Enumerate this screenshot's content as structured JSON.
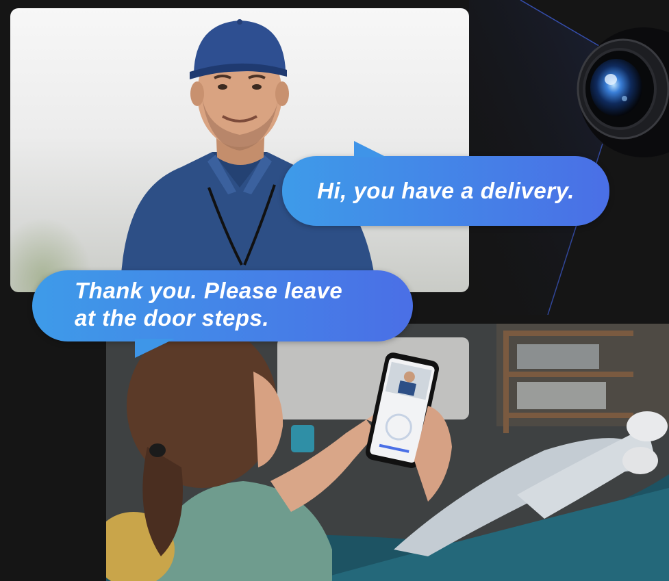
{
  "chat": {
    "incoming_message": "Hi, you have a delivery.",
    "reply_message": "Thank you. Please leave\nat the door steps."
  },
  "colors": {
    "background": "#151515",
    "bubble_start": "#3e9be9",
    "bubble_end": "#4a6fe6",
    "uniform_blue": "#2b4f8c"
  },
  "icons": {
    "camera": "security-camera-icon"
  }
}
